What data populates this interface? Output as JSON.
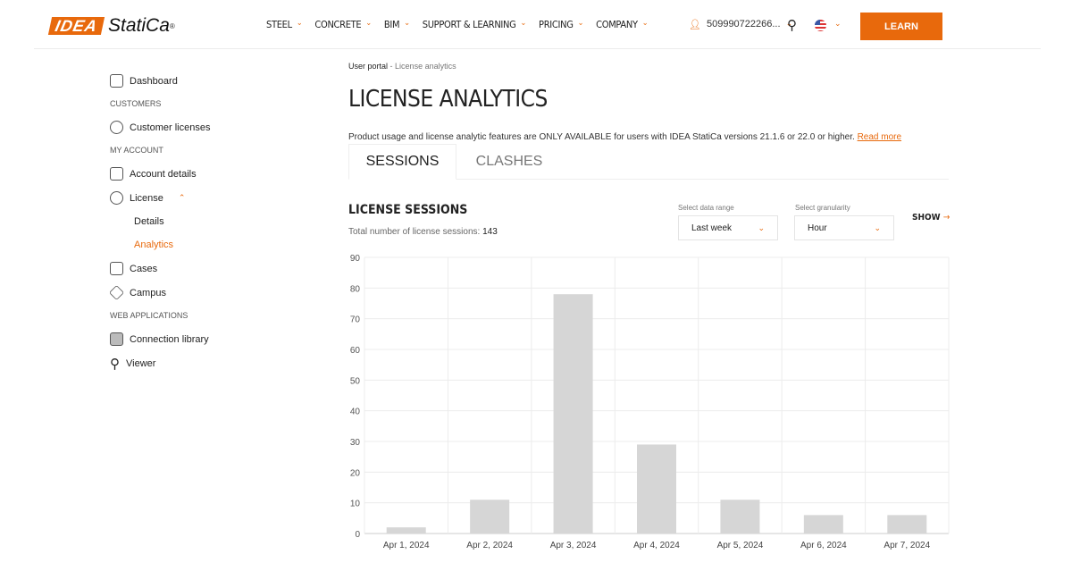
{
  "header": {
    "logo_box": "IDEA",
    "logo_text": "StatiCa",
    "nav": [
      "STEEL",
      "CONCRETE",
      "BIM",
      "SUPPORT & LEARNING",
      "PRICING",
      "COMPANY"
    ],
    "user": "509990722266...",
    "learn": "LEARN"
  },
  "sidebar": {
    "dashboard": "Dashboard",
    "customers": "CUSTOMERS",
    "customer_licenses": "Customer licenses",
    "my_account": "MY ACCOUNT",
    "account_details": "Account details",
    "license": "License",
    "details": "Details",
    "analytics": "Analytics",
    "cases": "Cases",
    "campus": "Campus",
    "web_apps": "WEB APPLICATIONS",
    "connection_library": "Connection library",
    "viewer": "Viewer"
  },
  "breadcrumb": {
    "root": "User portal",
    "sep": "-",
    "current": "License analytics"
  },
  "title": "LICENSE ANALYTICS",
  "note": {
    "text": "Product usage and license analytic features are ONLY AVAILABLE for users with IDEA StatiCa versions 21.1.6 or 22.0 or higher. ",
    "link": "Read more"
  },
  "tabs": {
    "sessions": "SESSIONS",
    "clashes": "CLASHES"
  },
  "sessions": {
    "title": "LICENSE SESSIONS",
    "total_label": "Total number of license sessions: ",
    "total": "143",
    "range_label": "Select data range",
    "range": "Last week",
    "gran_label": "Select granularity",
    "gran": "Hour",
    "show": "SHOW"
  },
  "chart_data": {
    "type": "bar",
    "categories": [
      "Apr 1, 2024",
      "Apr 2, 2024",
      "Apr 3, 2024",
      "Apr 4, 2024",
      "Apr 5, 2024",
      "Apr 6, 2024",
      "Apr 7, 2024"
    ],
    "values": [
      2,
      11,
      78,
      29,
      11,
      6,
      6
    ],
    "ylim": [
      0,
      90
    ],
    "yticks": [
      0,
      10,
      20,
      30,
      40,
      50,
      60,
      70,
      80,
      90
    ],
    "color": "#d6d6d6"
  }
}
